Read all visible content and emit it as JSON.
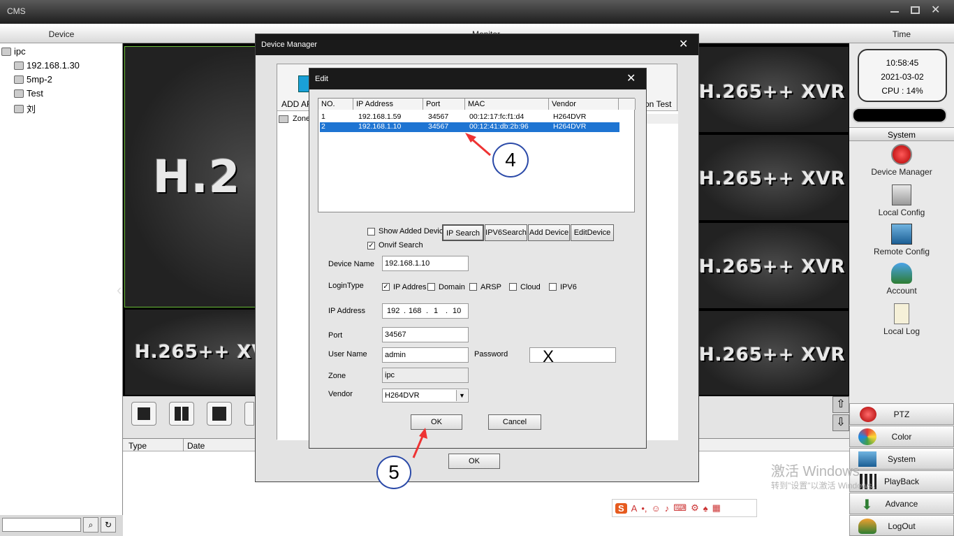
{
  "window": {
    "title": "CMS"
  },
  "headers": {
    "device": "Device",
    "monitor": "Monitor",
    "time": "Time"
  },
  "tree": {
    "root": "ipc",
    "items": [
      "192.168.1.30",
      "5mp-2",
      "Test",
      "刘"
    ]
  },
  "video": {
    "tile_text": "H.265++ XVR",
    "big_text": "H.2"
  },
  "clock": {
    "time": "10:58:45",
    "date": "2021-03-02",
    "cpu": "CPU : 14%"
  },
  "right_menu": {
    "section": "System",
    "items": [
      "Device Manager",
      "Local Config",
      "Remote Config",
      "Account",
      "Local Log"
    ]
  },
  "bottom_buttons": [
    "PTZ",
    "Color",
    "System",
    "PlayBack",
    "Advance",
    "LogOut"
  ],
  "log_table": {
    "columns": [
      "Type",
      "Date"
    ]
  },
  "device_manager": {
    "title": "Device Manager",
    "toolbar_left": "ADD AR",
    "toolbar_right": "on Test",
    "zone_label": "Zone",
    "ok": "OK"
  },
  "edit": {
    "title": "Edit",
    "columns": [
      "NO.",
      "IP Address",
      "Port",
      "MAC",
      "Vendor"
    ],
    "rows": [
      {
        "no": "1",
        "ip": "192.168.1.59",
        "port": "34567",
        "mac": "00:12:17:fc:f1:d4",
        "vendor": "H264DVR"
      },
      {
        "no": "2",
        "ip": "192.168.1.10",
        "port": "34567",
        "mac": "00:12:41:db:2b:96",
        "vendor": "H264DVR"
      }
    ],
    "show_added": "Show Added Devic",
    "onvif": "Onvif Search",
    "buttons": {
      "ip_search": "IP Search",
      "ipv6_search": "IPV6Search",
      "add_device": "Add Device",
      "edit_device": "EditDevice"
    },
    "labels": {
      "device_name": "Device Name",
      "login_type": "LoginType",
      "ip_address": "IP Address",
      "port": "Port",
      "user_name": "User Name",
      "password": "Password",
      "zone": "Zone",
      "vendor": "Vendor"
    },
    "login_types": [
      "IP Addres",
      "Domain",
      "ARSP",
      "Cloud",
      "IPV6"
    ],
    "values": {
      "device_name": "192.168.1.10",
      "ip": [
        "192",
        "168",
        "1",
        "10"
      ],
      "port": "34567",
      "user_name": "admin",
      "password": "X",
      "zone": "ipc",
      "vendor": "H264DVR"
    },
    "ok": "OK",
    "cancel": "Cancel"
  },
  "annotations": [
    "4",
    "5"
  ],
  "watermark": {
    "line1": "激活 Windows",
    "line2": "转到\"设置\"以激活 Windows。"
  }
}
